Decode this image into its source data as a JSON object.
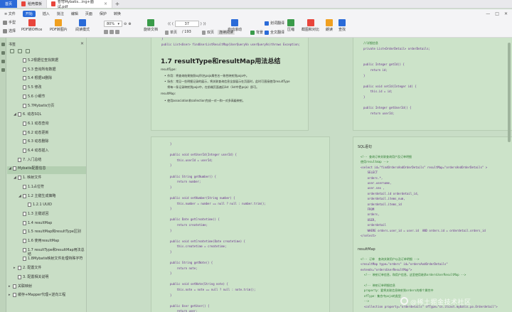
{
  "titlebar": {
    "home_tab": "首页",
    "tabs": [
      {
        "label": "稻壳模板",
        "active": false,
        "color": "#e8453c"
      },
      {
        "label": "苍穹Mybatis...ing+面试.pdf",
        "active": true,
        "color": "#e8453c"
      }
    ],
    "new_tab": "+"
  },
  "menubar": {
    "file": "≡ 文件",
    "items": [
      "开始",
      "插入",
      "批注",
      "编辑",
      "页面",
      "保护",
      "转换"
    ],
    "active": "开始",
    "window_controls": [
      "—",
      "□",
      "✕"
    ]
  },
  "toolbar": {
    "hand": "手型",
    "select": "选择",
    "pdf_to_office": "PDF转Office",
    "pdf_to_image": "PDF转图片",
    "read_mode": "阅读模式",
    "zoom": "80%",
    "rotate": "旋转文档",
    "page_current": "37",
    "page_total": "/ 193",
    "single_page": "单页",
    "double_page": "双页",
    "continuous": "连续阅读",
    "auto_scroll": "自动滚动",
    "background": "背景",
    "translate": "划词翻译",
    "full_translate": "全文翻译",
    "compress": "压缩",
    "screenshot_compare": "截图和对比",
    "read_aloud": "朗读",
    "find": "查找",
    "colors": {
      "blue": "#2a6bd8",
      "red": "#e8453c",
      "green": "#3a9b4a",
      "orange": "#f0a020"
    }
  },
  "sidebar": {
    "header": "书签",
    "close": "✕",
    "items": [
      {
        "indent": 2,
        "label": "5.2根据位查找数据",
        "tri": ""
      },
      {
        "indent": 2,
        "label": "5.3 查询所有数据",
        "tri": ""
      },
      {
        "indent": 2,
        "label": "5.4 根据id删除",
        "tri": ""
      },
      {
        "indent": 2,
        "label": "5.5 修改",
        "tri": ""
      },
      {
        "indent": 2,
        "label": "5.6 小细节",
        "tri": ""
      },
      {
        "indent": 2,
        "label": "5.7Mybatis分页",
        "tri": ""
      },
      {
        "indent": 1,
        "label": "6. 动态SQL",
        "tri": "◢"
      },
      {
        "indent": 2,
        "label": "6.1 动态查询",
        "tri": ""
      },
      {
        "indent": 2,
        "label": "6.2 动态更新",
        "tri": ""
      },
      {
        "indent": 2,
        "label": "6.3 动态删除",
        "tri": ""
      },
      {
        "indent": 2,
        "label": "6.4 动态插入",
        "tri": ""
      },
      {
        "indent": 1,
        "label": "7. 入门总结",
        "tri": ""
      },
      {
        "indent": 0,
        "label": "Mybatis配置信息",
        "tri": "◢",
        "highlight": true
      },
      {
        "indent": 1,
        "label": "1. 映射文件",
        "tri": "◢"
      },
      {
        "indent": 2,
        "label": "1.1占位符",
        "tri": ""
      },
      {
        "indent": 2,
        "label": "1.2 主键生成策略",
        "tri": "◢"
      },
      {
        "indent": 3,
        "label": "1.2.1 UUID",
        "tri": ""
      },
      {
        "indent": 2,
        "label": "1.3 主键返回",
        "tri": ""
      },
      {
        "indent": 2,
        "label": "1.4 resultMap",
        "tri": ""
      },
      {
        "indent": 2,
        "label": "1.5 resultMap和resultType区别",
        "tri": ""
      },
      {
        "indent": 2,
        "label": "1.6 使用resultMap",
        "tri": ""
      },
      {
        "indent": 2,
        "label": "1.7 resultType和resultMap用法总结",
        "tri": ""
      },
      {
        "indent": 2,
        "label": "1.8Mybatis映射文件处理特殊字符",
        "tri": ""
      },
      {
        "indent": 1,
        "label": "2. 配置文件",
        "tri": "▸"
      },
      {
        "indent": 1,
        "label": "3. 配置相关说明",
        "tri": ""
      },
      {
        "indent": 0,
        "label": "关联映射",
        "tri": "▸"
      },
      {
        "indent": 0,
        "label": "缓存+Mapper代理+逆向工程",
        "tri": "▸"
      }
    ]
  },
  "document": {
    "top_left_lines": [
      "}",
      "public List<User> findUserListResultMap(UserQueryVo userQueryVo)throws Exception;"
    ],
    "section_title": "1.7 resultType和resultMap用法总结",
    "resulttype_label": "resultType:",
    "resulttype_bullets": [
      "作用：将查询结果按照sql列名pojo属性名一致性映射到pojo中。",
      "场合：常见一些明细记录的展示，将关联查询信息全部展示在页面时，此时可直接使用resultType",
      "将每一条记录映射到pojo中，在前端页面遍历list（list中是pojo）即可。"
    ],
    "resultmap_label": "resultMap:",
    "resultmap_bullets": [
      "使用association和collection完成一对一和一对多高级映射。"
    ],
    "top_right_code": [
      "//详细信息",
      "private List<OrderDetail> orderDetails;",
      "",
      "",
      "public Integer getId() {",
      "    return id;",
      "}",
      "",
      "public void setId(Integer id) {",
      "    this.id = id;",
      "}",
      "",
      "public Integer getUserId() {",
      "    return userId;"
    ],
    "mid_left_code": [
      "}",
      "",
      "public void setUserId(Integer userId) {",
      "    this.userId = userId;",
      "}",
      "",
      "public String getNumber() {",
      "    return number;",
      "}",
      "",
      "public void setNumber(String number) {",
      "    this.number = number == null ? null : number.trim();",
      "}",
      "",
      "public Date getCreatetime() {",
      "    return createtime;",
      "}",
      "",
      "public void setCreatetime(Date createtime) {",
      "    this.createtime = createtime;",
      "}",
      "",
      "public String getNote() {",
      "    return note;",
      "}",
      "",
      "public void setNote(String note) {",
      "    this.note = note == null ? null : note.trim();",
      "}",
      "",
      "public User getUser() {",
      "    return user;",
      "}"
    ],
    "sql_title": "SQL语句",
    "sql_code": [
      "<!-- 查询订单关联查询用户及订单明细",
      "使用resultmap -->",
      "<select id=\"findOrdersAndOrderDetails\" resultMap=\"ordersAndOrderDetails\" >",
      "    SELECT",
      "    orders.*,",
      "    user.username,",
      "    user.sex ,",
      "    orderdetail.id orderdetail_id,",
      "    orderdetail.items_num,",
      "    orderdetail.items_id",
      "    FROM",
      "    orders,",
      "    USER,",
      "    orderdetail",
      "    WHERE orders.user_id = user.id  AND orders.id = orderdetail.orders_id",
      "</select>"
    ],
    "resultmap_title": "resultMap",
    "resultmap_code": [
      "<!-- 订单  查询关联用户以及订单明细 -->",
      "<resultMap type=\"orders\" id=\"ordersAndOrderDetails\"",
      "extends=\"ordersUserResultMap\">",
      "  <!-- 映射订单信息，和用户信息，这里使用继承ordersUserResultMap -->",
      "",
      "  <!-- 映射订单明细信息",
      "  property：要将关联信息映射到orders的哪个属性中",
      "  ofType：集合中pojo的类型",
      "  -->",
      "  <collection property=\"orderdetails\" ofType=\"cn.itcast.mybatis.po.Orderdetail\">"
    ]
  },
  "watermark": "@稀土掘金技术社区"
}
